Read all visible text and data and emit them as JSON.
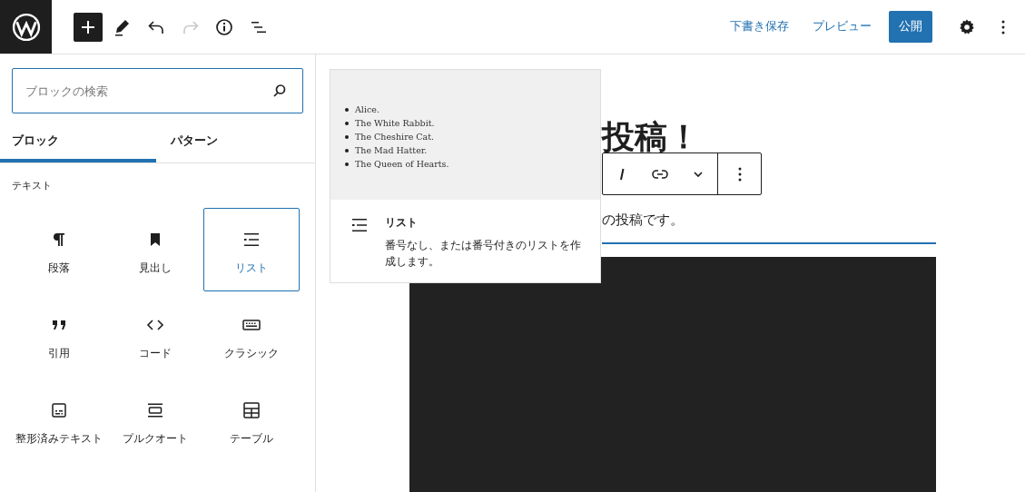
{
  "toolbar": [
    {
      "kind": "inserter",
      "pressed": true,
      "disabled": false
    },
    {
      "kind": "tools",
      "pressed": false,
      "disabled": false
    },
    {
      "kind": "undo",
      "pressed": false,
      "disabled": false
    },
    {
      "kind": "redo",
      "pressed": false,
      "disabled": true
    },
    {
      "kind": "details",
      "pressed": false,
      "disabled": false
    },
    {
      "kind": "outline",
      "pressed": false,
      "disabled": false
    }
  ],
  "actions": {
    "save_draft": "下書き保存",
    "preview": "プレビュー",
    "publish": "公開"
  },
  "sidebar": {
    "search": {
      "placeholder": "ブロックの検索"
    },
    "tabs": [
      {
        "label": "ブロック",
        "selected": true
      },
      {
        "label": "パターン",
        "selected": false
      }
    ],
    "category": "テキスト",
    "blocks": [
      {
        "kind": "paragraph",
        "label": "段落",
        "selected": false
      },
      {
        "kind": "heading",
        "label": "見出し",
        "selected": false
      },
      {
        "kind": "list",
        "label": "リスト",
        "selected": true
      },
      {
        "kind": "quote",
        "label": "引用",
        "selected": false
      },
      {
        "kind": "code",
        "label": "コード",
        "selected": false
      },
      {
        "kind": "classic",
        "label": "クラシック",
        "selected": false
      },
      {
        "kind": "preformatted",
        "label": "整形済みテキスト",
        "selected": false
      },
      {
        "kind": "pullquote",
        "label": "プルクオート",
        "selected": false
      },
      {
        "kind": "table",
        "label": "テーブル",
        "selected": false
      }
    ]
  },
  "preview_popover": {
    "sample_items": [
      "Alice.",
      "The White Rabbit.",
      "The Cheshire Cat.",
      "The Mad Hatter.",
      "The Queen of Hearts."
    ],
    "title": "リスト",
    "description": "番号なし、または番号付きのリストを作成します。"
  },
  "editor": {
    "title": "投稿！",
    "paragraph": "の投稿です。",
    "block_toolbar": [
      {
        "kind": "italic"
      },
      {
        "kind": "link"
      },
      {
        "kind": "more"
      },
      {
        "kind": "options"
      }
    ]
  }
}
